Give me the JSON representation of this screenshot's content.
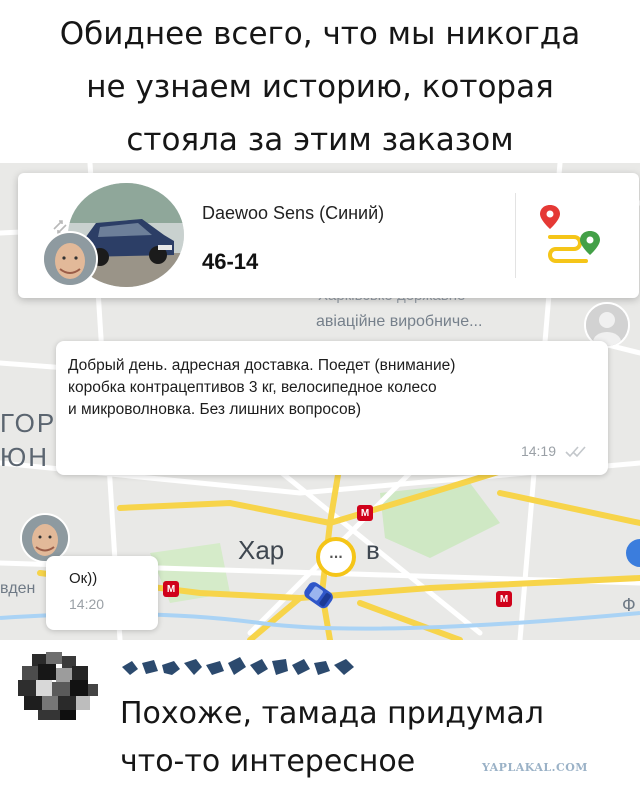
{
  "caption": {
    "lines": [
      "Обиднее всего, что мы никогда",
      "не узнаем историю, которая",
      "стояла за этим заказом"
    ]
  },
  "map": {
    "labels": {
      "area_top": "авіаційне виробниче...",
      "area_faded": "Харківсько державне",
      "left_1": "ГОР",
      "left_2": "ЮН",
      "city_part_1": "Хар",
      "city_part_2": "в",
      "left_bottom": "вден",
      "right_edge": "Ф"
    },
    "metro_letter": "M",
    "colors": {
      "background": "#e9e9e7",
      "road_major": "#f7d44a",
      "road_minor": "#ffffff",
      "park": "#cfe8c4",
      "metro": "#d0021b"
    }
  },
  "driver_card": {
    "car_model": "Daewoo Sens (Синий)",
    "plate": "46-14",
    "icons": {
      "car_photo": "car-photo",
      "driver_photo": "driver-avatar",
      "swap": "swap-arrows-icon",
      "route": "route-icon"
    },
    "accent_color": "#f5c518",
    "pin_color": "#e53935",
    "route_end_color": "#4caf50"
  },
  "chat": {
    "incoming": {
      "lines": [
        "Добрый день. адресная доставка. Поедет (внимание)",
        "коробка контрацептивов 3 кг, велосипедное колесо",
        "и микроволновка. Без лишних вопросов)"
      ],
      "time": "14:19",
      "status_icon": "double-check-icon"
    },
    "outgoing": {
      "text": "Ок))",
      "time": "14:20"
    },
    "typing_indicator": "···"
  },
  "comment": {
    "lines": [
      "Похоже, тамада придумал",
      "что-то интересное"
    ],
    "watermark": "YAPLAKAL.COM"
  }
}
